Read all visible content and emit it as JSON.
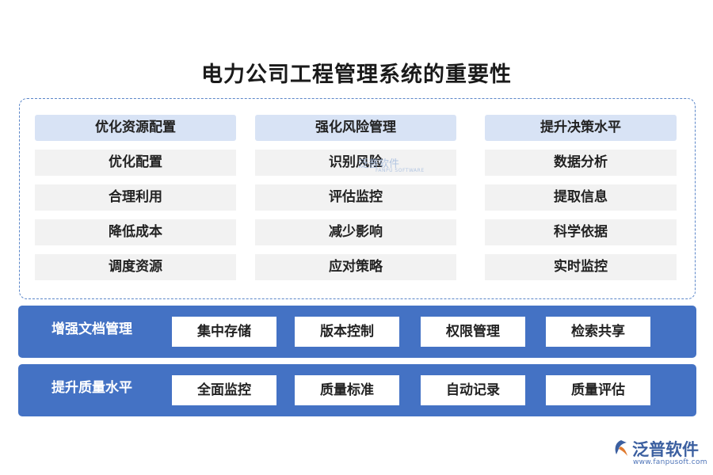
{
  "title": "电力公司工程管理系统的重要性",
  "columns": [
    {
      "header": "优化资源配置",
      "items": [
        "优化配置",
        "合理利用",
        "降低成本",
        "调度资源"
      ]
    },
    {
      "header": "强化风险管理",
      "items": [
        "识别风险",
        "评估监控",
        "减少影响",
        "应对策略"
      ]
    },
    {
      "header": "提升决策水平",
      "items": [
        "数据分析",
        "提取信息",
        "科学依据",
        "实时监控"
      ]
    }
  ],
  "bands": [
    {
      "label": "增强文档管理",
      "items": [
        "集中存储",
        "版本控制",
        "权限管理",
        "检索共享"
      ]
    },
    {
      "label": "提升质量水平",
      "items": [
        "全面监控",
        "质量标准",
        "自动记录",
        "质量评估"
      ]
    }
  ],
  "watermark": {
    "name": "泛普软件",
    "sub": "FANPU SOFTWARE"
  },
  "logo": {
    "name": "泛普软件",
    "url": "www.fanpusoft.com",
    "icon": "fanpu-logo-icon"
  },
  "colors": {
    "accent": "#4472c4",
    "header_bg": "#d8e3f5",
    "item_bg": "#f2f2f2",
    "border": "#5b86c9"
  }
}
